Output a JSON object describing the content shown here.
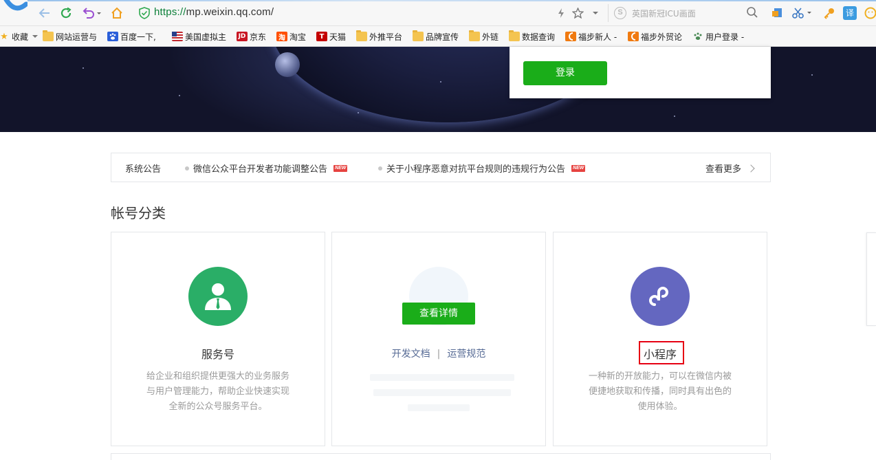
{
  "browser": {
    "url_scheme": "https://",
    "url_host": "mp.weixin.qq.com/",
    "search_placeholder": "英国新冠ICU画面",
    "translate_label": "译",
    "search_logo_letter": "S"
  },
  "bookmarks": [
    {
      "label": "收藏",
      "icon": "star-icon"
    },
    {
      "label": "网站运营与",
      "icon": "folder-icon"
    },
    {
      "label": "百度一下,",
      "icon": "baidu-icon"
    },
    {
      "label": "美国虚拟主",
      "icon": "flag-icon"
    },
    {
      "label": "京东",
      "icon": "jd-icon",
      "icon_text": "JD"
    },
    {
      "label": "淘宝",
      "icon": "taobao-icon",
      "icon_text": "淘"
    },
    {
      "label": "天猫",
      "icon": "tmall-icon",
      "icon_text": "T"
    },
    {
      "label": "外推平台",
      "icon": "folder-icon"
    },
    {
      "label": "品牌宣传",
      "icon": "folder-icon"
    },
    {
      "label": "外链",
      "icon": "folder-icon"
    },
    {
      "label": "数据查询",
      "icon": "folder-icon"
    },
    {
      "label": "福步新人 -",
      "icon": "fobshanghai-icon"
    },
    {
      "label": "福步外贸论",
      "icon": "fobshanghai-icon"
    },
    {
      "label": "用户登录 -",
      "icon": "paw-icon"
    }
  ],
  "hero": {
    "login_label": "登录"
  },
  "notice": {
    "label": "系统公告",
    "items": [
      {
        "text": "微信公众平台开发者功能调整公告",
        "badge": "NEW"
      },
      {
        "text": "关于小程序恶意对抗平台规则的违规行为公告",
        "badge": "NEW"
      }
    ],
    "more_label": "查看更多"
  },
  "section": {
    "title": "帐号分类"
  },
  "cards": [
    {
      "name": "服务号",
      "icon": "service-account-icon",
      "color": "#2aae67",
      "desc_lines": [
        "给企业和组织提供更强大的业务服务",
        "与用户管理能力，帮助企业快速实现",
        "全新的公众号服务平台。"
      ]
    },
    {
      "detail_button": "查看详情",
      "link_docs": "开发文档",
      "link_sep": "|",
      "link_rules": "运营规范"
    },
    {
      "name": "小程序",
      "icon": "mini-program-icon",
      "color": "#6467c0",
      "desc_lines": [
        "一种新的开放能力，可以在微信内被",
        "便捷地获取和传播，同时具有出色的",
        "使用体验。"
      ]
    }
  ],
  "colors": {
    "brand_green": "#1aad19",
    "link_blue": "#576b95",
    "highlight_red": "#e60012"
  }
}
